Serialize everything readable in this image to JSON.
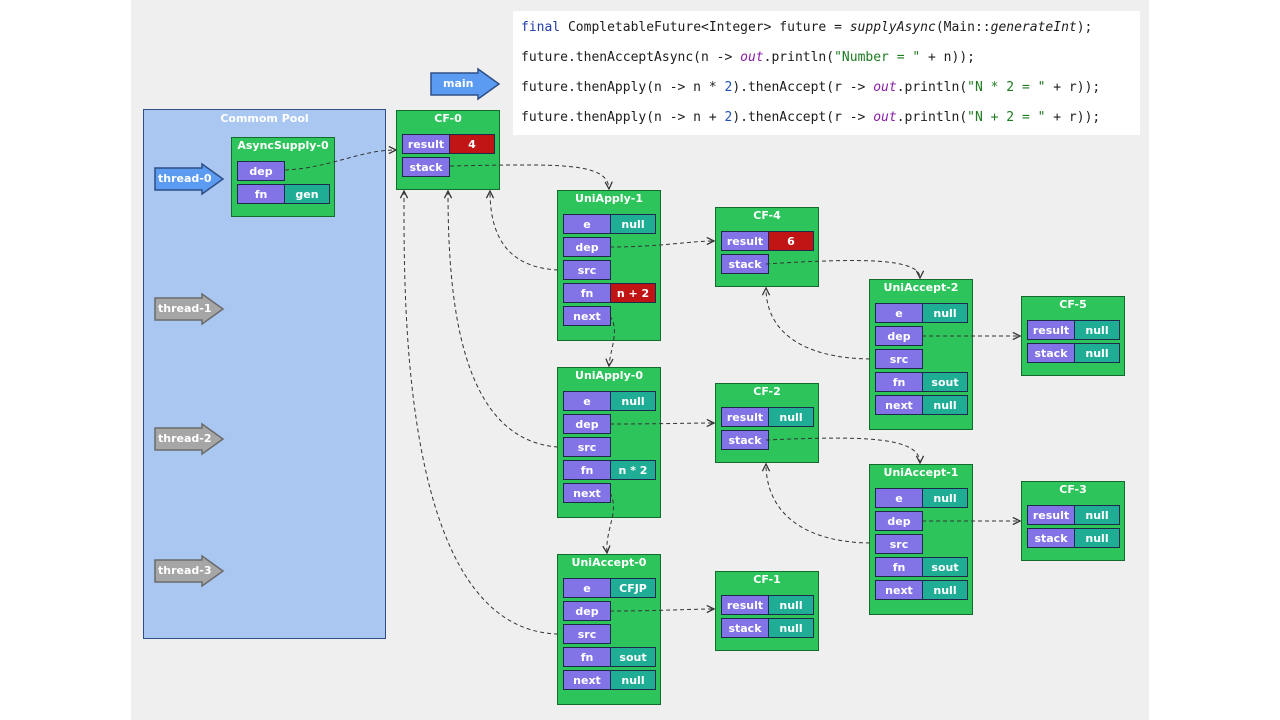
{
  "code": {
    "line1": {
      "kw": "final",
      "a": " CompletableFuture<Integer> future = ",
      "fn": "supplyAsync",
      "b": "(Main::",
      "ref": "generateInt",
      "c": ");"
    },
    "line2": {
      "a": "future.thenAcceptAsync(n -> ",
      "out": "out",
      "b": ".println(",
      "str": "\"Number = \"",
      "c": " + n));"
    },
    "line3": {
      "a": "future.thenApply(n -> n * ",
      "num": "2",
      "b": ").thenAccept(r -> ",
      "out": "out",
      "c": ".println(",
      "str": "\"N * 2 = \"",
      "d": " + r));"
    },
    "line4": {
      "a": "future.thenApply(n -> n + ",
      "num": "2",
      "b": ").thenAccept(r -> ",
      "out": "out",
      "c": ".println(",
      "str": "\"N + 2 = \"",
      "d": " + r));"
    }
  },
  "main_label": "main",
  "pool_title": "Commom Pool",
  "threads": [
    "thread-0",
    "thread-1",
    "thread-2",
    "thread-3"
  ],
  "colors": {
    "node": "#2ec45c",
    "label_cell": "#8273e6",
    "value_cell": "#1fad96",
    "result_cell": "#c11414",
    "pool": "#a9c7f1",
    "active_thread": "#5b9bf2",
    "idle_thread": "#a6a6a6"
  },
  "nodes": {
    "async_supply_0": {
      "title": "AsyncSupply-0",
      "dep": "dep",
      "fn": "fn",
      "fn_val": "gen"
    },
    "cf0": {
      "title": "CF-0",
      "result": "result",
      "result_val": "4",
      "stack": "stack"
    },
    "uni_apply_1": {
      "title": "UniApply-1",
      "e": "e",
      "e_val": "null",
      "dep": "dep",
      "src": "src",
      "fn": "fn",
      "fn_val": "n + 2",
      "next": "next"
    },
    "uni_apply_0": {
      "title": "UniApply-0",
      "e": "e",
      "e_val": "null",
      "dep": "dep",
      "src": "src",
      "fn": "fn",
      "fn_val": "n * 2",
      "next": "next"
    },
    "uni_accept_0": {
      "title": "UniAccept-0",
      "e": "e",
      "e_val": "CFJP",
      "dep": "dep",
      "src": "src",
      "fn": "fn",
      "fn_val": "sout",
      "next": "next",
      "next_val": "null"
    },
    "cf4": {
      "title": "CF-4",
      "result": "result",
      "result_val": "6",
      "stack": "stack"
    },
    "cf2": {
      "title": "CF-2",
      "result": "result",
      "result_val": "null",
      "stack": "stack"
    },
    "cf1": {
      "title": "CF-1",
      "result": "result",
      "result_val": "null",
      "stack": "stack",
      "stack_val": "null"
    },
    "uni_accept_2": {
      "title": "UniAccept-2",
      "e": "e",
      "e_val": "null",
      "dep": "dep",
      "src": "src",
      "fn": "fn",
      "fn_val": "sout",
      "next": "next",
      "next_val": "null"
    },
    "uni_accept_1": {
      "title": "UniAccept-1",
      "e": "e",
      "e_val": "null",
      "dep": "dep",
      "src": "src",
      "fn": "fn",
      "fn_val": "sout",
      "next": "next",
      "next_val": "null"
    },
    "cf5": {
      "title": "CF-5",
      "result": "result",
      "result_val": "null",
      "stack": "stack",
      "stack_val": "null"
    },
    "cf3": {
      "title": "CF-3",
      "result": "result",
      "result_val": "null",
      "stack": "stack",
      "stack_val": "null"
    }
  }
}
